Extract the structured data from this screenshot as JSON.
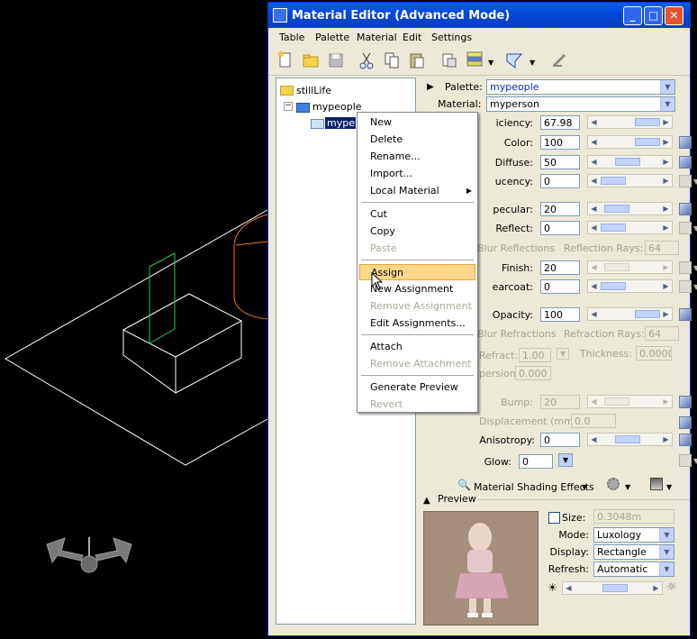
{
  "window": {
    "title": "Material Editor (Advanced Mode)",
    "minimize": "_",
    "maximize": "□",
    "close": "✕"
  },
  "menubar": [
    "Table",
    "Palette",
    "Material",
    "Edit",
    "Settings"
  ],
  "tree": {
    "root": "stillLife",
    "palette": "mypeople",
    "material": "myperson",
    "material_visible": "myper..."
  },
  "header_fields": {
    "palette_label": "Palette:",
    "palette_value": "mypeople",
    "material_label": "Material:",
    "material_value": "myperson"
  },
  "properties": {
    "efficiency_label": "iciency:",
    "efficiency_value": "67.98",
    "color_label": "Color:",
    "color_value": "100",
    "diffuse_label": "Diffuse:",
    "diffuse_value": "50",
    "translucency_label": "ucency:",
    "translucency_value": "0",
    "specular_label": "pecular:",
    "specular_value": "20",
    "reflect_label": "Reflect:",
    "reflect_value": "0",
    "blur_reflections_label": "Blur Reflections",
    "reflection_rays_label": "Reflection Rays:",
    "reflection_rays_value": "64",
    "finish_label": "Finish:",
    "finish_value": "20",
    "clearcoat_label": "earcoat:",
    "clearcoat_value": "0",
    "opacity_label": "Opacity:",
    "opacity_value": "100",
    "blur_refractions_label": "Blur Refractions",
    "refraction_rays_label": "Refraction Rays:",
    "refraction_rays_value": "64",
    "refract_label": "Refract:",
    "refract_value": "1.00",
    "thickness_label": "Thickness:",
    "thickness_value": "0.0000",
    "dispersion_label": "persion:",
    "dispersion_value": "0.000",
    "bump_label": "Bump:",
    "bump_value": "20",
    "displacement_label": "Displacement (mm):",
    "displacement_value": "0.0",
    "anisotropy_label": "Anisotropy:",
    "anisotropy_value": "0",
    "glow_label": "Glow:",
    "glow_value": "0"
  },
  "shading": {
    "label": "Material Shading Effects"
  },
  "preview": {
    "header": "Preview",
    "size_label": "Size:",
    "size_value": "0.3048m",
    "mode_label": "Mode:",
    "mode_value": "Luxology",
    "display_label": "Display:",
    "display_value": "Rectangle",
    "refresh_label": "Refresh:",
    "refresh_value": "Automatic"
  },
  "context_menu": {
    "items": [
      {
        "label": "New",
        "enabled": true
      },
      {
        "label": "Delete",
        "enabled": true
      },
      {
        "label": "Rename...",
        "enabled": true
      },
      {
        "label": "Import...",
        "enabled": true
      },
      {
        "label": "Local Material",
        "enabled": true,
        "submenu": true
      },
      {
        "label": "Cut",
        "enabled": true
      },
      {
        "label": "Copy",
        "enabled": true
      },
      {
        "label": "Paste",
        "enabled": false
      },
      {
        "label": "Assign",
        "enabled": true,
        "highlighted": true
      },
      {
        "label": "New Assignment",
        "enabled": true
      },
      {
        "label": "Remove Assignment",
        "enabled": false
      },
      {
        "label": "Edit Assignments...",
        "enabled": true
      },
      {
        "label": "Attach",
        "enabled": true
      },
      {
        "label": "Remove Attachment",
        "enabled": false
      },
      {
        "label": "Generate Preview",
        "enabled": true
      },
      {
        "label": "Revert",
        "enabled": false
      }
    ]
  }
}
